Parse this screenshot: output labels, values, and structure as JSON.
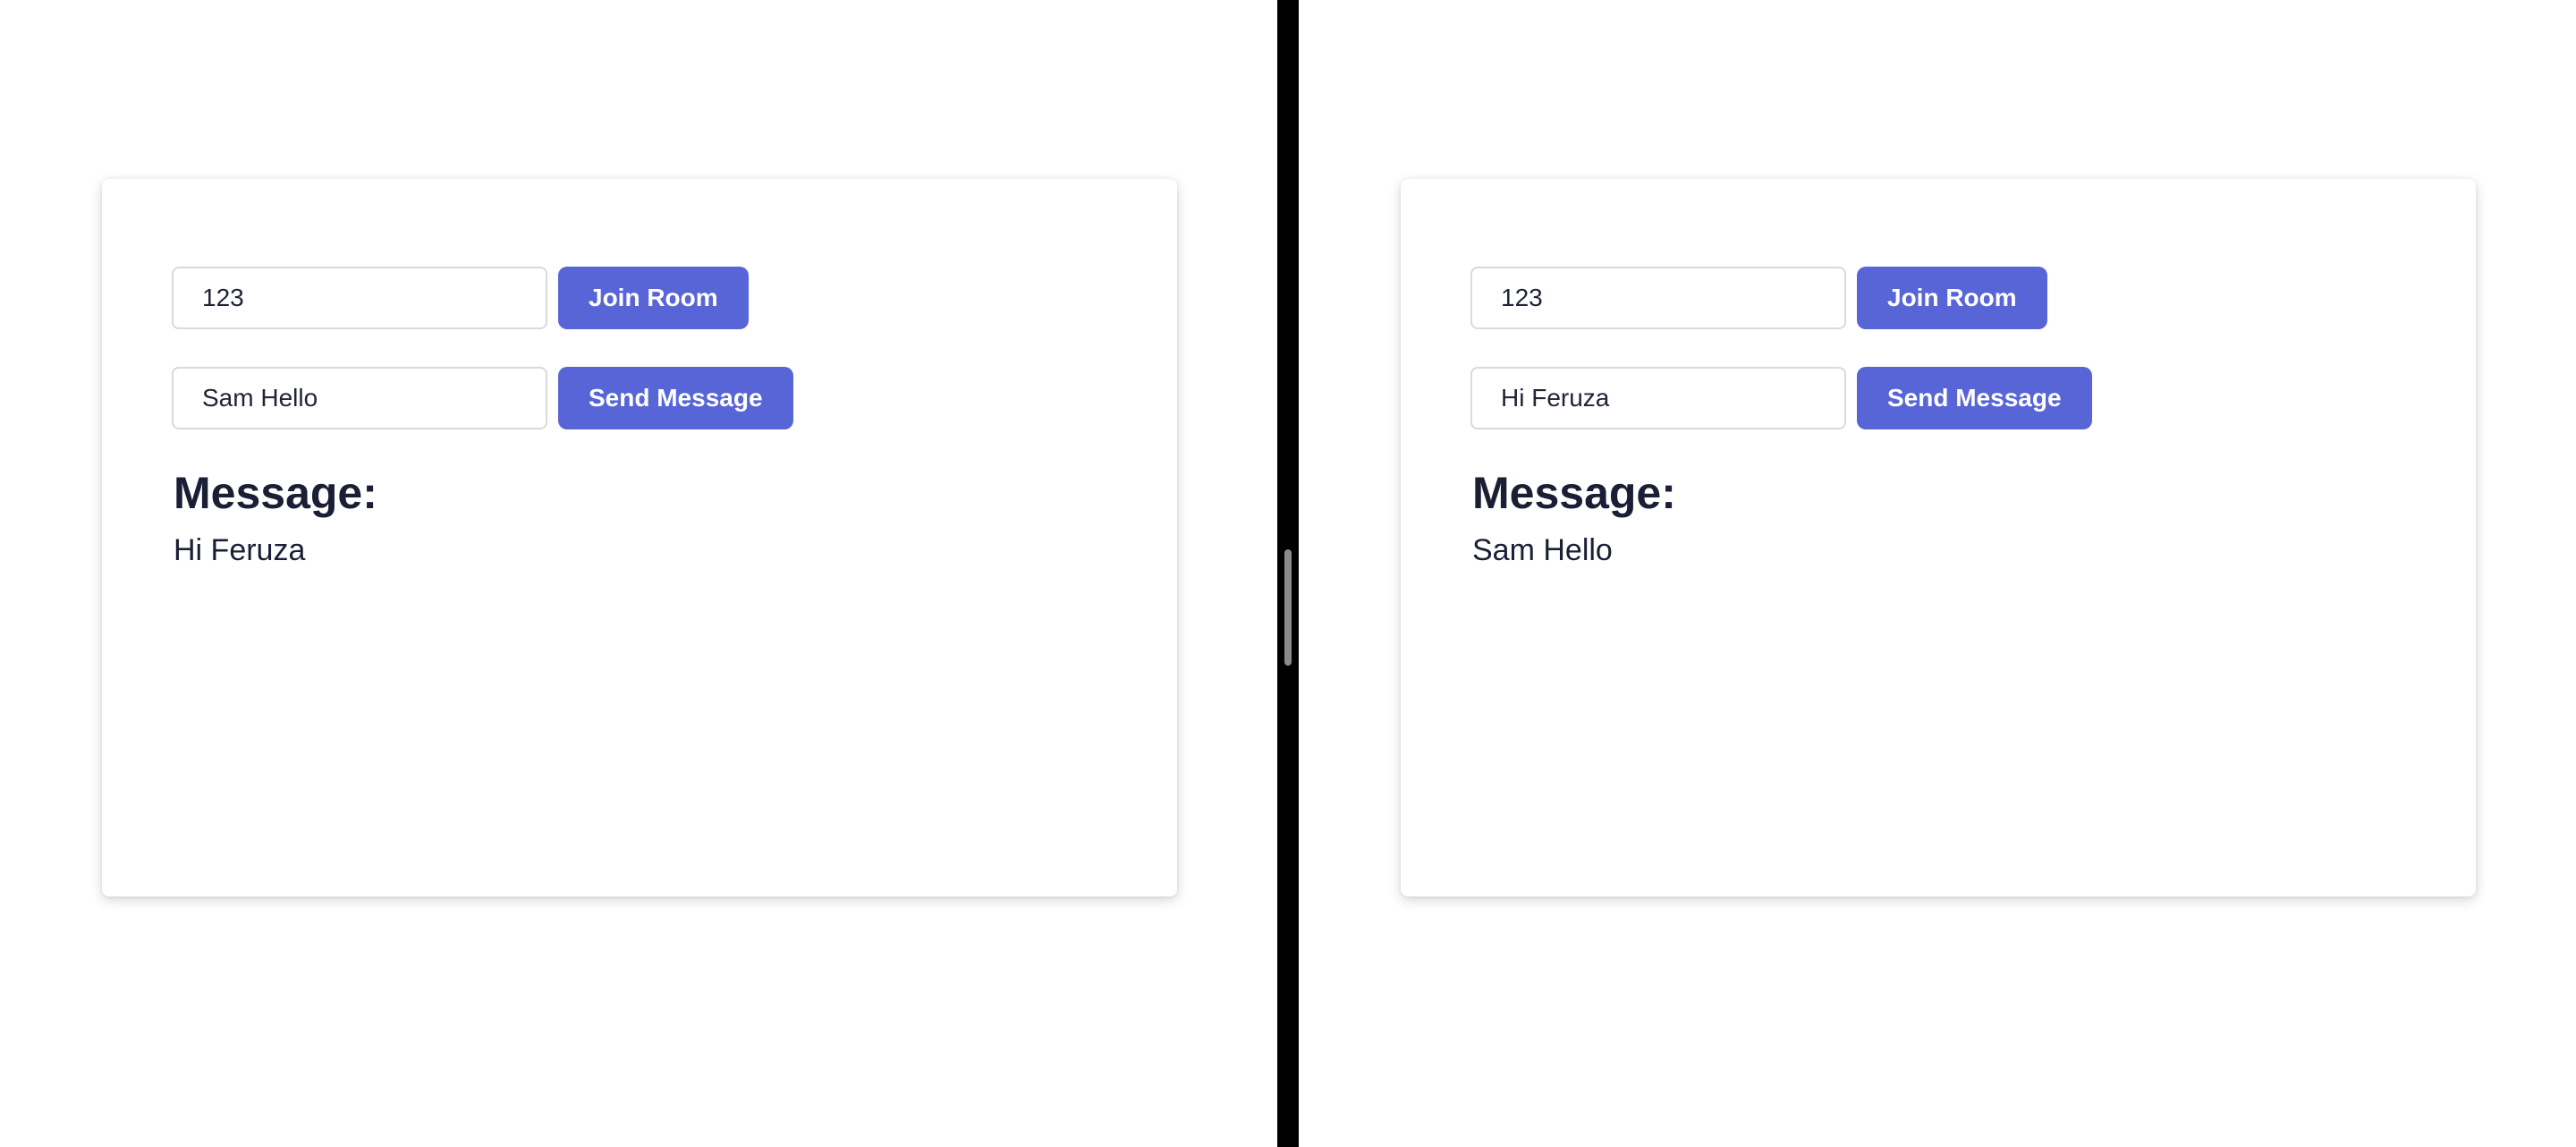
{
  "colors": {
    "accent": "#5865d6",
    "divider": "#000000",
    "text": "#1a1f36"
  },
  "panes": [
    {
      "room_input": {
        "value": "123"
      },
      "join_button": {
        "label": "Join Room"
      },
      "message_input": {
        "value": "Sam Hello"
      },
      "send_button": {
        "label": "Send Message"
      },
      "heading": "Message:",
      "received_message": "Hi Feruza"
    },
    {
      "room_input": {
        "value": "123"
      },
      "join_button": {
        "label": "Join Room"
      },
      "message_input": {
        "value": "Hi Feruza"
      },
      "send_button": {
        "label": "Send Message"
      },
      "heading": "Message:",
      "received_message": "Sam Hello"
    }
  ]
}
